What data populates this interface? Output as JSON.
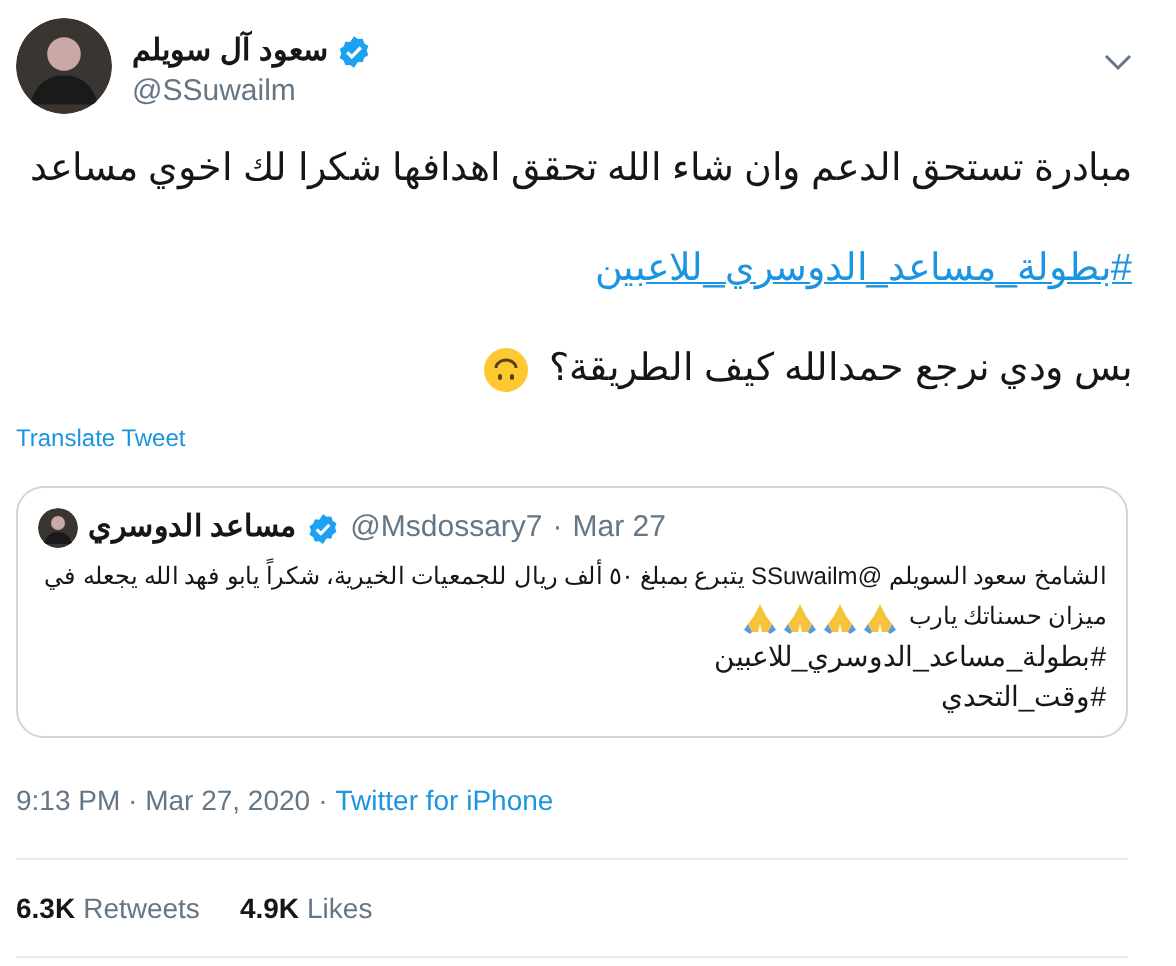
{
  "author": {
    "name": "سعود آل سويلم",
    "handle": "@SSuwailm",
    "verified": true
  },
  "tweet": {
    "lines": [
      {
        "kind": "text",
        "text": "مبادرة تستحق الدعم وان شاء الله تحقق اهدافها شكرا لك اخوي مساعد"
      },
      {
        "kind": "hashtag",
        "text": "#بطولة_مساعد_الدوسري_للاعبين"
      },
      {
        "kind": "text",
        "text": "بس ودي نرجع حمدالله كيف الطريقة؟",
        "emoji": true
      }
    ]
  },
  "translate_link": "Translate Tweet",
  "quoted": {
    "name": "مساعد الدوسري",
    "verified": true,
    "handle": "@Msdossary7",
    "separator": "·",
    "date": "Mar 27",
    "text_lines": [
      "الشامخ سعود السويلم @SSuwailm يتبرع بمبلغ ٥٠ ألف ريال للجمعيات الخيرية، شكراً يابو فهد الله يجعله في",
      "ميزان حسناتك يارب"
    ],
    "reactions": [
      {
        "kind": "pray"
      },
      {
        "kind": "pray"
      },
      {
        "kind": "pray"
      },
      {
        "kind": "pray"
      }
    ],
    "hashtags": [
      "#بطولة_مساعد_الدوسري_للاعبين",
      "#وقت_التحدي"
    ]
  },
  "meta": {
    "time": "9:13 PM · Mar 27, 2020",
    "separator": "·",
    "source": "Twitter for iPhone"
  },
  "retweets": {
    "count": "6.3K",
    "label": "Retweets"
  },
  "likes": {
    "count": "4.9K",
    "label": "Likes"
  }
}
